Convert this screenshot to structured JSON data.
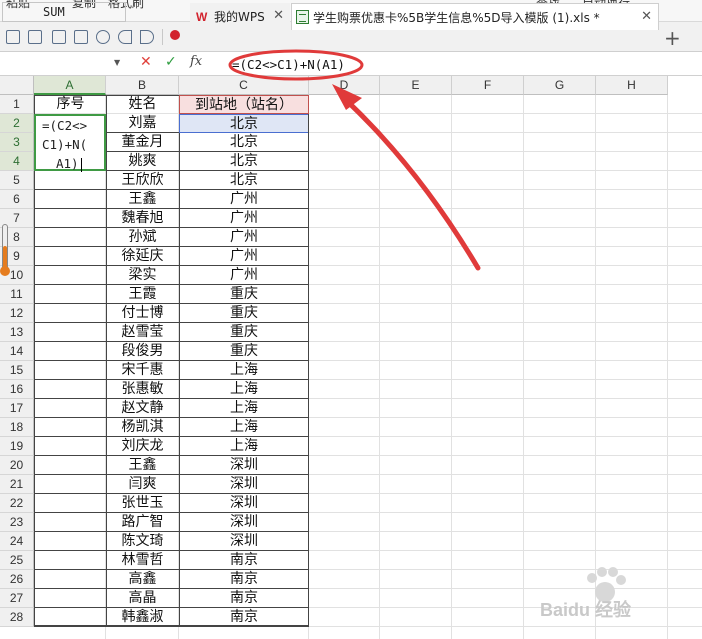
{
  "ribbon": {
    "items": [
      "粘贴",
      "复制",
      "格式刷",
      "查找",
      "自动换行"
    ]
  },
  "tabs": [
    {
      "label": "我的WPS",
      "active": false
    },
    {
      "label": "学生购票优惠卡%5B学生信息%5D导入模版 (1).xls *",
      "active": true
    }
  ],
  "name_box": "SUM",
  "formula": "=(C2<>C1)+N(A1)",
  "fx_label": "fx",
  "columns": [
    "A",
    "B",
    "C",
    "D",
    "E",
    "F",
    "G",
    "H"
  ],
  "rows": [
    "1",
    "2",
    "3",
    "4",
    "5",
    "6",
    "7",
    "8",
    "9",
    "10",
    "11",
    "12",
    "13",
    "14",
    "15",
    "16",
    "17",
    "18",
    "19",
    "20",
    "21",
    "22",
    "23",
    "24",
    "25",
    "26",
    "27",
    "28"
  ],
  "table": {
    "headers": {
      "a": "序号",
      "b": "姓名",
      "c": "到站地（站名）"
    },
    "editing_lines": [
      "=(C2<>",
      "C1)+N(",
      "A1)"
    ],
    "records": [
      {
        "name": "刘嘉",
        "station": "北京"
      },
      {
        "name": "董金月",
        "station": "北京"
      },
      {
        "name": "姚爽",
        "station": "北京"
      },
      {
        "name": "王欣欣",
        "station": "北京"
      },
      {
        "name": "王鑫",
        "station": "广州"
      },
      {
        "name": "魏春旭",
        "station": "广州"
      },
      {
        "name": "孙斌",
        "station": "广州"
      },
      {
        "name": "徐延庆",
        "station": "广州"
      },
      {
        "name": "梁实",
        "station": "广州"
      },
      {
        "name": "王霞",
        "station": "重庆"
      },
      {
        "name": "付士博",
        "station": "重庆"
      },
      {
        "name": "赵雪莹",
        "station": "重庆"
      },
      {
        "name": "段俊男",
        "station": "重庆"
      },
      {
        "name": "宋千惠",
        "station": "上海"
      },
      {
        "name": "张惠敏",
        "station": "上海"
      },
      {
        "name": "赵文静",
        "station": "上海"
      },
      {
        "name": "杨凯淇",
        "station": "上海"
      },
      {
        "name": "刘庆龙",
        "station": "上海"
      },
      {
        "name": "王鑫",
        "station": "深圳"
      },
      {
        "name": "闫爽",
        "station": "深圳"
      },
      {
        "name": "张世玉",
        "station": "深圳"
      },
      {
        "name": "路广智",
        "station": "深圳"
      },
      {
        "name": "陈文琦",
        "station": "深圳"
      },
      {
        "name": "林雪哲",
        "station": "南京"
      },
      {
        "name": "高鑫",
        "station": "南京"
      },
      {
        "name": "高晶",
        "station": "南京"
      },
      {
        "name": "韩鑫淑",
        "station": "南京"
      }
    ]
  },
  "watermark": "Baidu 经验",
  "colors": {
    "annotation": "#e03a3a",
    "active_cell": "#3f9a44",
    "header_fill": "#f8dfdf",
    "ref_fill": "#dfe6f5"
  }
}
